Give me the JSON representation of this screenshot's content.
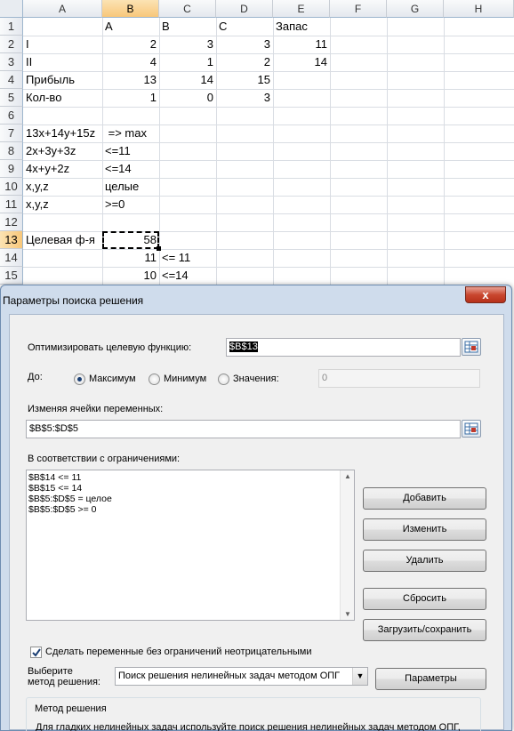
{
  "spreadsheet": {
    "columns": [
      "A",
      "B",
      "C",
      "D",
      "E",
      "F",
      "G",
      "H"
    ],
    "rows": [
      "1",
      "2",
      "3",
      "4",
      "5",
      "6",
      "7",
      "8",
      "9",
      "10",
      "11",
      "12",
      "13",
      "14",
      "15"
    ],
    "cells": {
      "B1": "A",
      "C1": "B",
      "D1": "C",
      "E1": "Запас",
      "A2": "I",
      "B2": "2",
      "C2": "3",
      "D2": "3",
      "E2": "11",
      "A3": "II",
      "B3": "4",
      "C3": "1",
      "D3": "2",
      "E3": "14",
      "A4": "Прибыль",
      "B4": "13",
      "C4": "14",
      "D4": "15",
      "A5": "Кол-во",
      "B5": "1",
      "C5": "0",
      "D5": "3",
      "A7": "13x+14y+15z",
      "B7": " => max",
      "A8": "2x+3y+3z",
      "B8": "<=11",
      "A9": "4x+y+2z",
      "B9": "<=14",
      "A10": "x,y,z",
      "B10": "целые",
      "A11": "x,y,z",
      "B11": ">=0",
      "A13": "Целевая ф-я",
      "B13": "58",
      "B14": "11",
      "C14": "<= 11",
      "B15": "10",
      "C15": "<=14"
    },
    "active_cell": "B13"
  },
  "dialog": {
    "title": "Параметры поиска решения",
    "close_label": "x",
    "objective_label": "Оптимизировать целевую функцию:",
    "objective_value": "$B$13",
    "to_label": "До:",
    "radio_max": "Максимум",
    "radio_min": "Минимум",
    "radio_value": "Значения:",
    "value_field": "0",
    "selected_goal": "max",
    "changing_label": "Изменяя ячейки переменных:",
    "changing_value": "$B$5:$D$5",
    "constraints_label": "В соответствии с ограничениями:",
    "constraints": [
      "$B$14 <= 11",
      "$B$15 <= 14",
      "$B$5:$D$5 = целое",
      "$B$5:$D$5 >= 0"
    ],
    "btn_add": "Добавить",
    "btn_change": "Изменить",
    "btn_delete": "Удалить",
    "btn_reset": "Сбросить",
    "btn_load_save": "Загрузить/сохранить",
    "checkbox_label": "Сделать переменные без ограничений неотрицательными",
    "checkbox_checked": true,
    "method_label_1": "Выберите",
    "method_label_2": "метод решения:",
    "method_value": "Поиск решения нелинейных задач методом ОПГ",
    "btn_params": "Параметры",
    "group_title": "Метод решения",
    "group_text": "Для гладких нелинейных задач используйте поиск решения нелинейных задач методом ОПГ, для линейных задач - поиск решения линейных задач симплекс-методом, а для негладких задач - эволюционный поиск решения."
  }
}
